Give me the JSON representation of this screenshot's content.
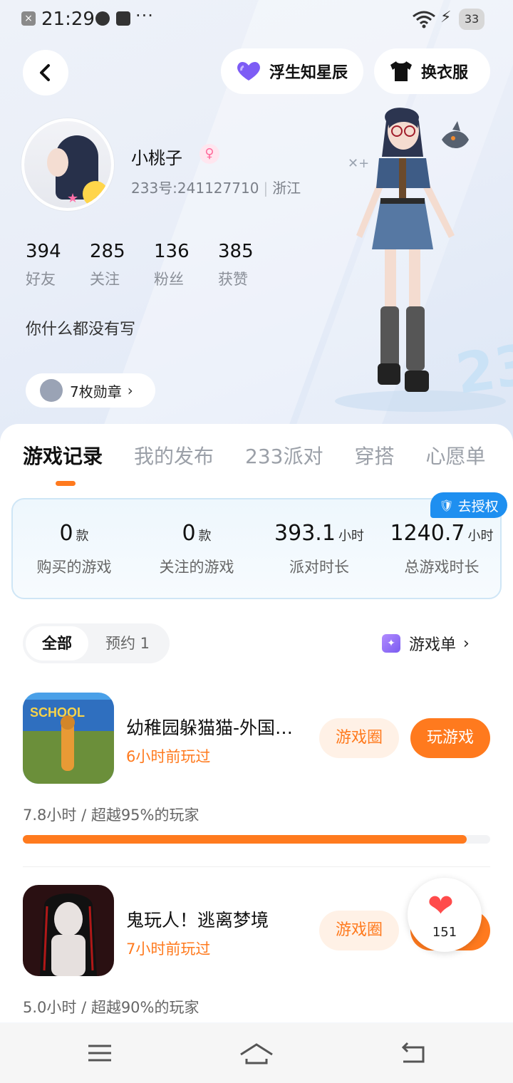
{
  "status_bar": {
    "time": "21:29",
    "notif_box": "×",
    "dots": "···",
    "battery": "33"
  },
  "header": {
    "star_button": "浮生知星辰",
    "dress_button": "换衣服"
  },
  "profile": {
    "name": "小桃子",
    "gender_symbol": "♀",
    "id_text": "233号:241127710",
    "region": "浙江",
    "stats": [
      {
        "value": "394",
        "label": "好友"
      },
      {
        "value": "285",
        "label": "关注"
      },
      {
        "value": "136",
        "label": "粉丝"
      },
      {
        "value": "385",
        "label": "获赞"
      }
    ],
    "bio": "你什么都没有写",
    "medal_label": "7枚勋章",
    "chevron": "›"
  },
  "tabs": [
    "游戏记录",
    "我的发布",
    "233派对",
    "穿搭",
    "心愿单"
  ],
  "summary": {
    "auth_label": "去授权",
    "cells": [
      {
        "value": "0",
        "unit": "款",
        "label": "购买的游戏"
      },
      {
        "value": "0",
        "unit": "款",
        "label": "关注的游戏"
      },
      {
        "value": "393.1",
        "unit": "小时",
        "label": "派对时长"
      },
      {
        "value": "1240.7",
        "unit": "小时",
        "label": "总游戏时长"
      }
    ]
  },
  "filter": {
    "all": "全部",
    "reserve": "预约 1",
    "game_list": "游戏单"
  },
  "games": [
    {
      "title": "幼稚园躲猫猫-外国…",
      "played": "6小时前玩过",
      "circle_btn": "游戏圈",
      "play_btn": "玩游戏",
      "progress_text": "7.8小时 / 超越95%的玩家",
      "progress": 0.95
    },
    {
      "title": "鬼玩人！逃离梦境",
      "played": "7小时前玩过",
      "circle_btn": "游戏圈",
      "play_btn": "玩游戏",
      "progress_text": "5.0小时 / 超越90%的玩家",
      "progress": 0.9
    }
  ],
  "like_float": {
    "count": "151"
  },
  "colors": {
    "accent": "#ff7a1e",
    "auth_blue": "#1e8ff0",
    "heart": "#ff4b4b"
  }
}
